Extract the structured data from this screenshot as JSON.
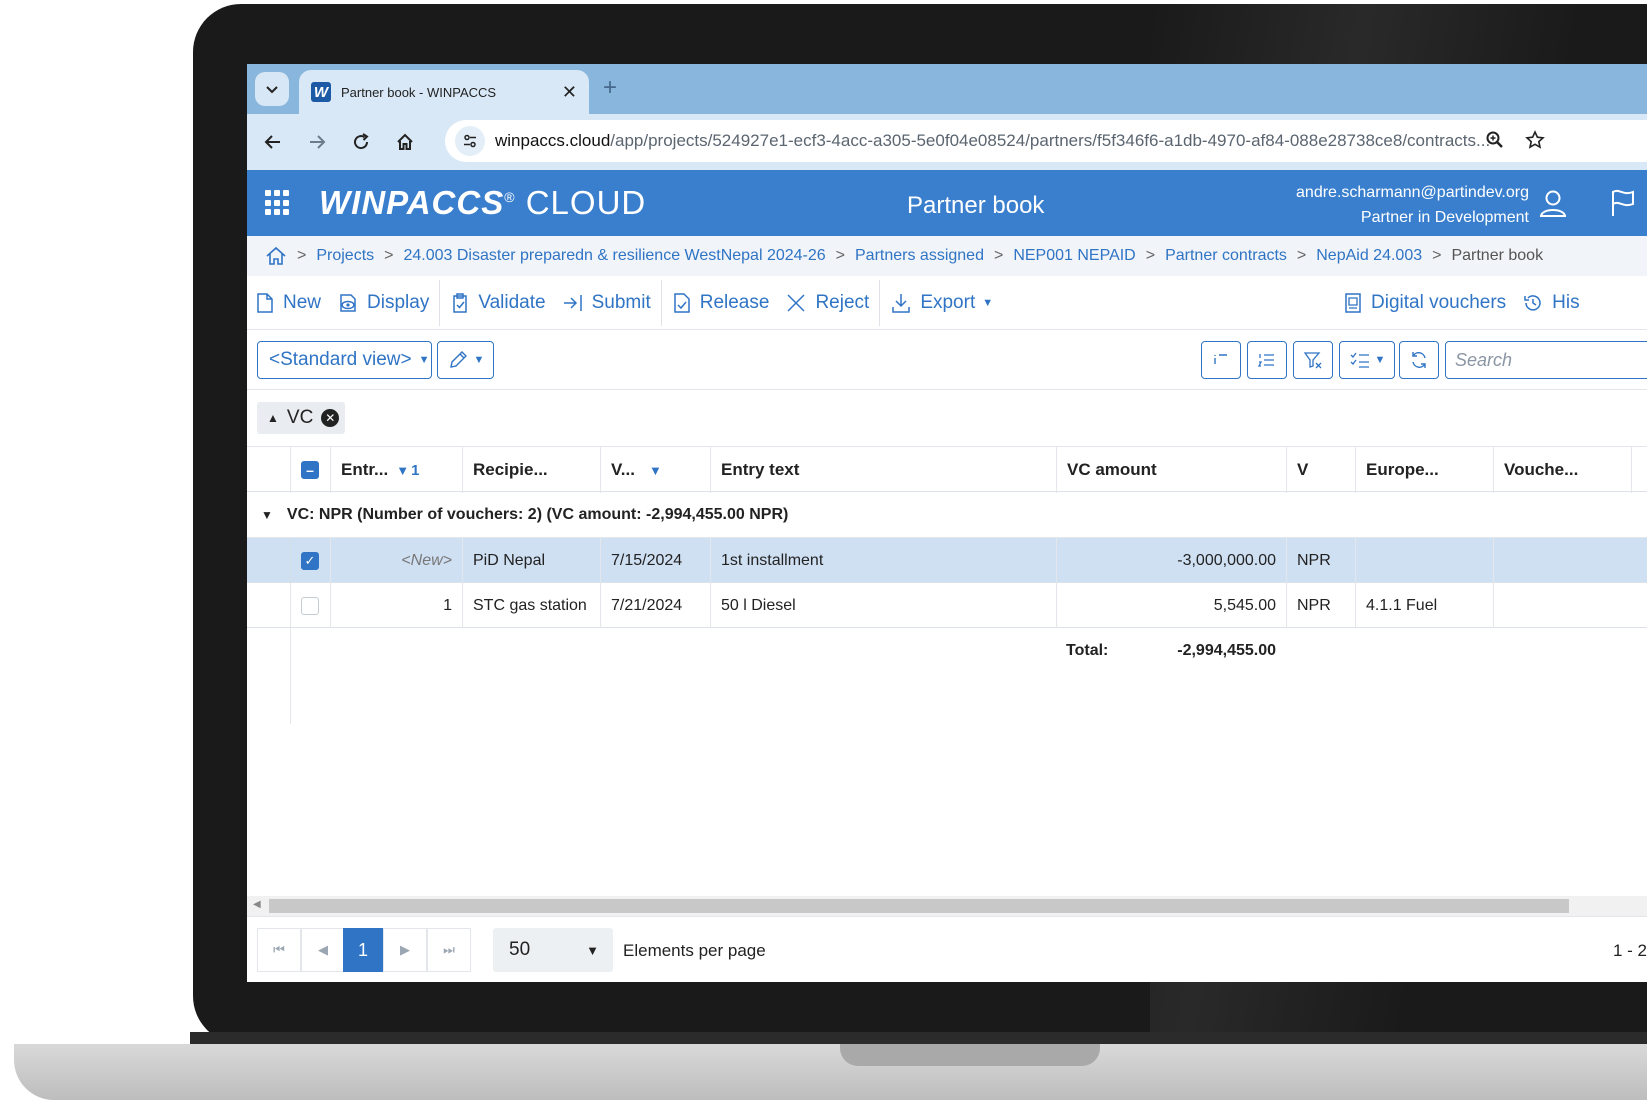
{
  "browser": {
    "tab_title": "Partner book - WINPACCS",
    "tab_favicon": "W",
    "url_host": "winpaccs.cloud",
    "url_path": "/app/projects/524927e1-ecf3-4acc-a305-5e0f04e08524/partners/f5f346f6-a1db-4970-af84-088e28738ce8/contracts..."
  },
  "app": {
    "logo_brand": "WINPACCS",
    "logo_reg": "®",
    "logo_suffix": "CLOUD",
    "title": "Partner book",
    "user_email": "andre.scharmann@partindev.org",
    "user_org": "Partner in Development",
    "accent_color": "#3a7fce"
  },
  "breadcrumb": {
    "items": [
      "Projects",
      "24.003 Disaster preparedn & resilience WestNepal 2024-26",
      "Partners assigned",
      "NEP001 NEPAID",
      "Partner contracts",
      "NepAid 24.003"
    ],
    "current": "Partner book",
    "separator": ">"
  },
  "toolbar": {
    "new": "New",
    "display": "Display",
    "validate": "Validate",
    "submit": "Submit",
    "release": "Release",
    "reject": "Reject",
    "export": "Export",
    "digital_vouchers": "Digital vouchers",
    "history": "His"
  },
  "viewbar": {
    "view_label": "<Standard view>",
    "search_placeholder": "Search"
  },
  "group_chip": {
    "label": "VC"
  },
  "grid": {
    "columns": [
      "Entr...",
      "Recipie...",
      "V...",
      "Entry text",
      "VC amount",
      "V",
      "Europe...",
      "Vouche..."
    ],
    "entry_sort_index": "1",
    "group_label": "VC: NPR (Number of vouchers: 2) (VC amount: -2,994,455.00 NPR)",
    "rows": [
      {
        "entry": "<New>",
        "recipient": "PiD Nepal",
        "date": "7/15/2024",
        "text": "1st installment",
        "amount": "-3,000,000.00",
        "currency": "NPR",
        "european": "",
        "voucher": "",
        "selected": true
      },
      {
        "entry": "1",
        "recipient": "STC gas station",
        "date": "7/21/2024",
        "text": "50 l Diesel",
        "amount": "5,545.00",
        "currency": "NPR",
        "european": "4.1.1 Fuel",
        "voucher": "",
        "selected": false
      }
    ],
    "total_label": "Total:",
    "total_value": "-2,994,455.00"
  },
  "pager": {
    "current_page": "1",
    "page_size": "50",
    "per_page_label": "Elements per page",
    "range": "1 - 2"
  }
}
